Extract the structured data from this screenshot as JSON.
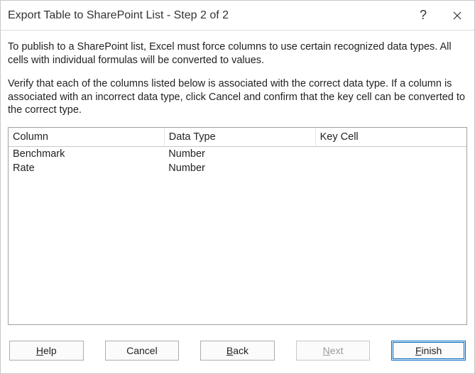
{
  "titlebar": {
    "title": "Export Table to SharePoint List - Step 2 of 2",
    "help_icon": "?",
    "close_icon": "×"
  },
  "instructions": {
    "p1": "To publish to a SharePoint list, Excel must force columns to use certain recognized data types. All cells with individual formulas will be converted to values.",
    "p2": "Verify that each of the columns listed below is associated with the correct data type. If a column is associated with an incorrect data type, click Cancel and confirm that the key cell can be converted to the correct type."
  },
  "table": {
    "headers": {
      "column": "Column",
      "datatype": "Data Type",
      "keycell": "Key Cell"
    },
    "rows": [
      {
        "column": "Benchmark",
        "datatype": "Number",
        "keycell": ""
      },
      {
        "column": "Rate",
        "datatype": "Number",
        "keycell": ""
      }
    ]
  },
  "buttons": {
    "help_pre": "H",
    "help_post": "elp",
    "cancel": "Cancel",
    "back_pre": "B",
    "back_post": "ack",
    "next_pre": "N",
    "next_post": "ext",
    "finish_pre": "F",
    "finish_post": "inish"
  }
}
